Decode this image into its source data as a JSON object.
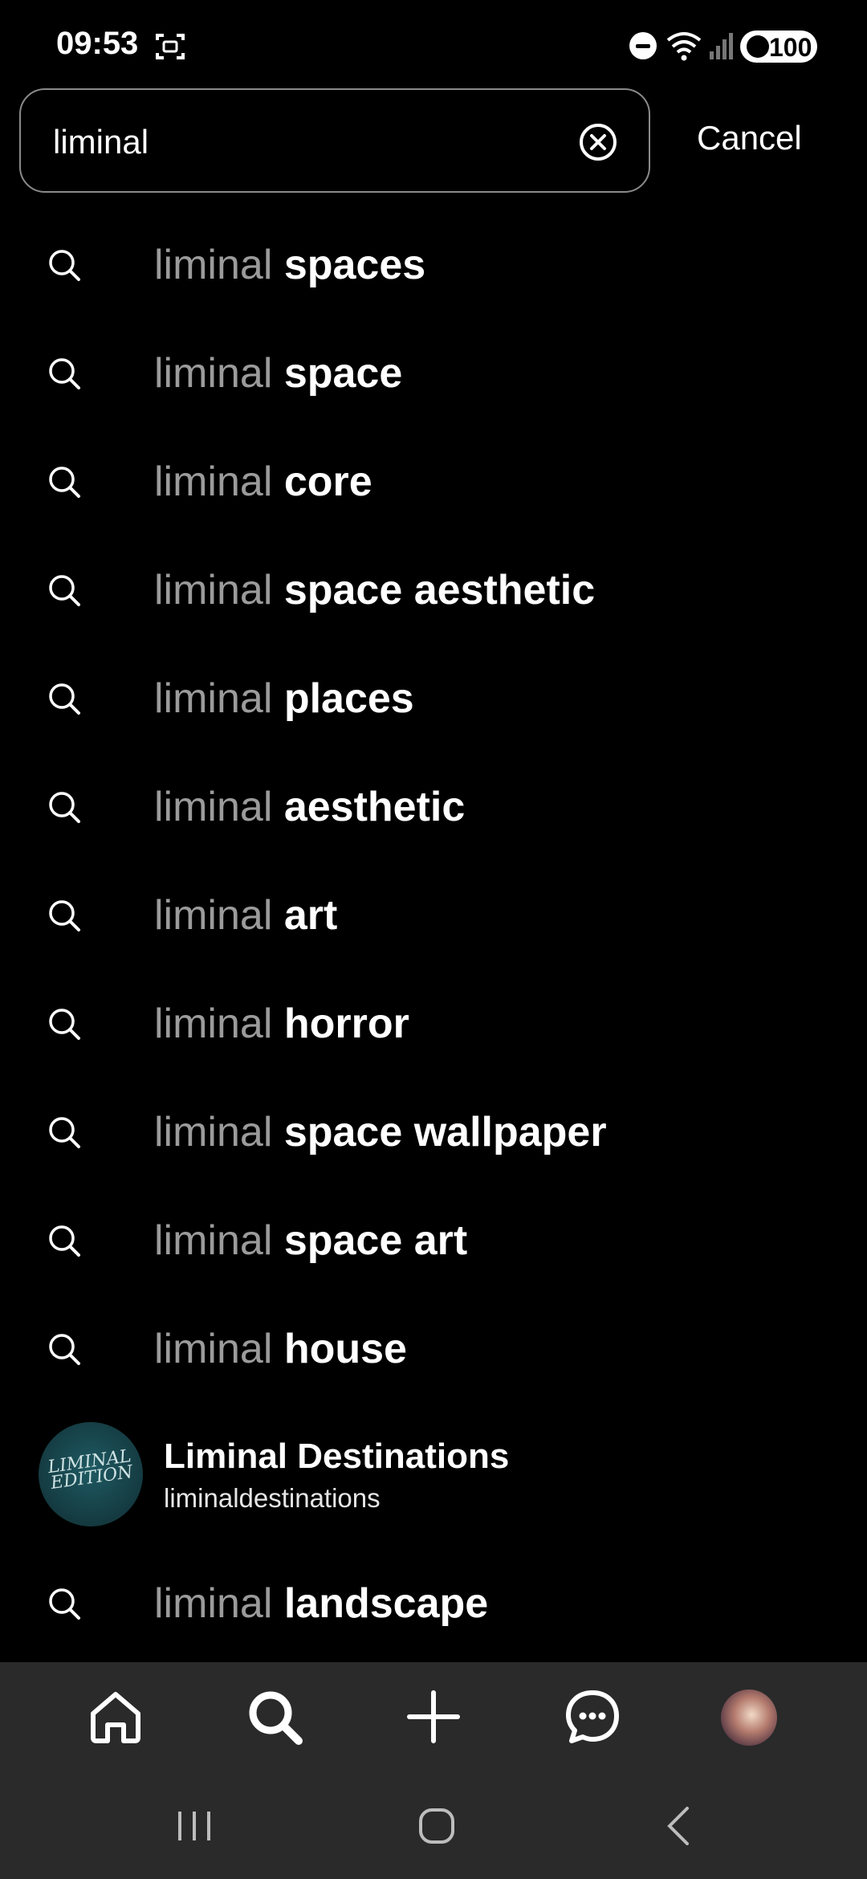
{
  "status_bar": {
    "time": "09:53",
    "battery": "100",
    "icons": [
      "screenshot-icon",
      "do-not-disturb-icon",
      "wifi-icon",
      "signal-icon",
      "battery-icon"
    ]
  },
  "search": {
    "value": "liminal",
    "cancel_label": "Cancel"
  },
  "suggestions_before_account": [
    {
      "prefix": "liminal",
      "suffix": "spaces"
    },
    {
      "prefix": "liminal",
      "suffix": "space"
    },
    {
      "prefix": "liminal",
      "suffix": "core"
    },
    {
      "prefix": "liminal",
      "suffix": "space aesthetic"
    },
    {
      "prefix": "liminal",
      "suffix": "places"
    },
    {
      "prefix": "liminal",
      "suffix": "aesthetic"
    },
    {
      "prefix": "liminal",
      "suffix": "art"
    },
    {
      "prefix": "liminal",
      "suffix": "horror"
    },
    {
      "prefix": "liminal",
      "suffix": "space wallpaper"
    },
    {
      "prefix": "liminal",
      "suffix": "space art"
    },
    {
      "prefix": "liminal",
      "suffix": "house"
    }
  ],
  "account": {
    "name": "Liminal Destinations",
    "handle": "liminaldestinations",
    "avatar_text": "LIMINAL EDITION"
  },
  "suggestions_after_account": [
    {
      "prefix": "liminal",
      "suffix": "landscape"
    }
  ],
  "tab_bar": {
    "tabs": [
      "home-icon",
      "search-icon",
      "create-icon",
      "messages-icon",
      "profile-avatar"
    ],
    "active": "search-icon",
    "background": "#2a2a2a"
  },
  "colors": {
    "background": "#000000",
    "prefix_text": "#9b9b9b",
    "suffix_text": "#ffffff"
  }
}
